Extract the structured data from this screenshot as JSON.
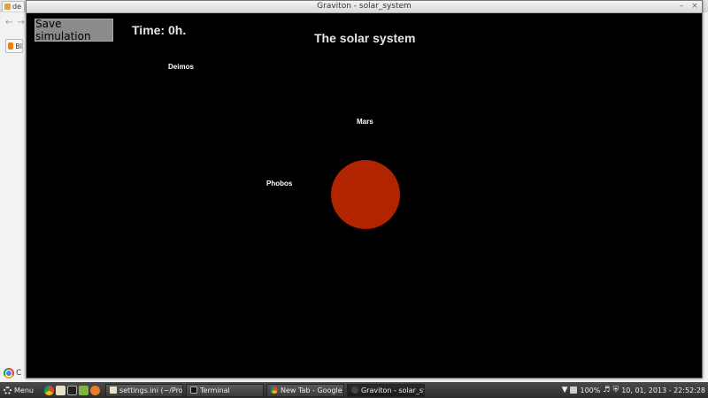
{
  "background_browser": {
    "tab_label": "de",
    "bookmark_label": "Bl",
    "bottom_label": "C"
  },
  "window": {
    "title": "Graviton - solar_system",
    "minimize": "–",
    "close": "×"
  },
  "simulation": {
    "save_button": "Save simulation",
    "time": "Time: 0h.",
    "title": "The solar system",
    "bodies": [
      {
        "name": "Deimos",
        "color": ""
      },
      {
        "name": "Mars",
        "color": "#b22400"
      },
      {
        "name": "Phobos",
        "color": ""
      }
    ]
  },
  "taskbar": {
    "menu_label": "Menu",
    "tasks": [
      {
        "label": "settings.ini (~/Proj..."
      },
      {
        "label": "Terminal"
      },
      {
        "label": "New Tab - Google C..."
      },
      {
        "label": "Graviton - solar_sys..."
      }
    ],
    "battery": "100%",
    "clock": "10, 01, 2013 - 22:52:28"
  },
  "colors": {
    "canvas_background": "#000000",
    "mars": "#b22400",
    "button_gray": "#8b8b8b"
  }
}
